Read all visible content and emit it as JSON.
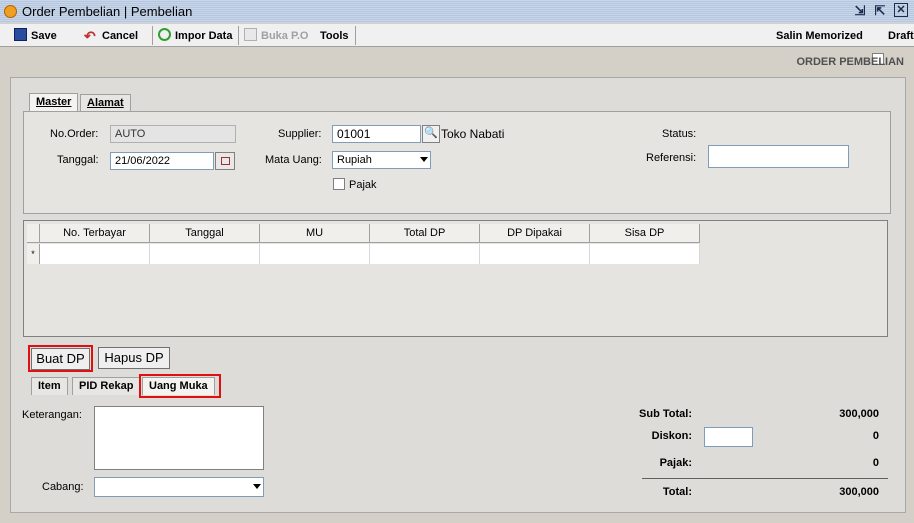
{
  "window": {
    "title": "Order Pembelian | Pembelian"
  },
  "toolbar": {
    "save": "Save",
    "cancel": "Cancel",
    "import": "Impor Data",
    "open_po": "Buka P.O",
    "tools": "Tools",
    "memorized": "Salin Memorized",
    "draft": "Draft"
  },
  "screen_label": "ORDER PEMBELIAN",
  "top_tabs": [
    {
      "label": "Master"
    },
    {
      "label": "Alamat"
    }
  ],
  "master": {
    "no_order_label": "No.Order:",
    "no_order_value": "AUTO",
    "tanggal_label": "Tanggal:",
    "tanggal_value": "21/06/2022",
    "supplier_label": "Supplier:",
    "supplier_value": "01001",
    "supplier_name": "Toko Nabati",
    "mata_uang_label": "Mata Uang:",
    "mata_uang_value": "Rupiah",
    "pajak_label": "Pajak",
    "status_label": "Status:",
    "referensi_label": "Referensi:",
    "referensi_value": ""
  },
  "dp_grid": {
    "columns": [
      "No. Terbayar",
      "Tanggal",
      "MU",
      "Total DP",
      "DP Dipakai",
      "Sisa DP"
    ],
    "new_row_marker": "*"
  },
  "buttons": {
    "buat_dp": "Buat DP",
    "hapus_dp": "Hapus DP"
  },
  "bottom_tabs": [
    {
      "label": "Item"
    },
    {
      "label": "PID Rekap"
    },
    {
      "label": "Uang Muka"
    }
  ],
  "bottom": {
    "keterangan_label": "Keterangan:",
    "cabang_label": "Cabang:"
  },
  "totals": {
    "sub_total_label": "Sub Total:",
    "sub_total_value": "300,000",
    "diskon_label": "Diskon:",
    "diskon_value": "0",
    "pajak_label": "Pajak:",
    "pajak_value": "0",
    "total_label": "Total:",
    "total_value": "300,000"
  },
  "colors": {
    "highlight": "#e01010",
    "titlebar": "#b9c9e1"
  }
}
